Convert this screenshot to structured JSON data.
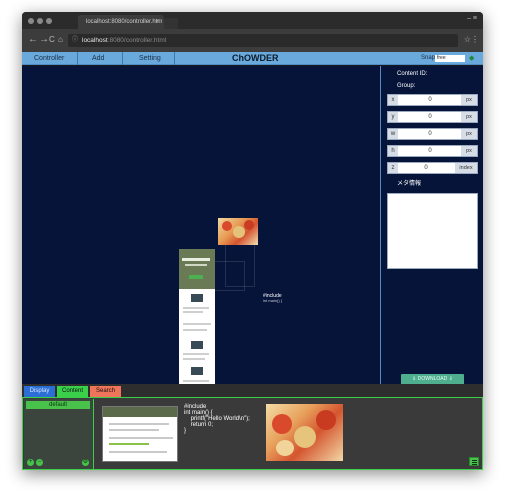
{
  "browser": {
    "tab_title": "localhost:8080/controller.htm",
    "tab_close": "×",
    "url_host": "localhost",
    "url_path": ":8080/controller.html",
    "lock_glyph": "ⓘ",
    "back_glyph": "←",
    "forward_glyph": "→",
    "reload_glyph": "C",
    "home_glyph": "⌂",
    "star_glyph": "☆",
    "menu_glyph": "⋮",
    "window_controls": "– ≡"
  },
  "menubar": {
    "controller": "Controller",
    "add": "Add",
    "setting": "Setting",
    "app_name": "ChOWDER",
    "snap_label": "Snap:",
    "snap_value": "free"
  },
  "display": {
    "code_node_title": "#include",
    "code_node_sub": "int main() {"
  },
  "properties": {
    "content_id_label": "Content ID:",
    "group_label": "Group:",
    "fields": [
      {
        "key": "x",
        "value": "0",
        "unit": "px"
      },
      {
        "key": "y",
        "value": "0",
        "unit": "px"
      },
      {
        "key": "w",
        "value": "0",
        "unit": "px"
      },
      {
        "key": "h",
        "value": "0",
        "unit": "px"
      },
      {
        "key": "z",
        "value": "0",
        "unit": "index"
      }
    ],
    "meta_label": "メタ情報",
    "meta_value": "",
    "download_label": "DOWNLOAD"
  },
  "bottom_tabs": {
    "display": "Display",
    "content": "Content",
    "search": "Search"
  },
  "content_list": {
    "group_default": "default",
    "add_icon": "+",
    "remove_icon": "−",
    "settings_icon": "⚙",
    "code_snippet": "#include\nint main() {\n    printf(\"Hello World\\n\");\n    return 0;\n}"
  },
  "colors": {
    "accent_blue": "#6aa9dc",
    "panel_navy": "#06143a",
    "green": "#48c24a",
    "display_tab": "#2b6fd6",
    "content_tab": "#3ad04a",
    "search_tab": "#f0745a"
  }
}
